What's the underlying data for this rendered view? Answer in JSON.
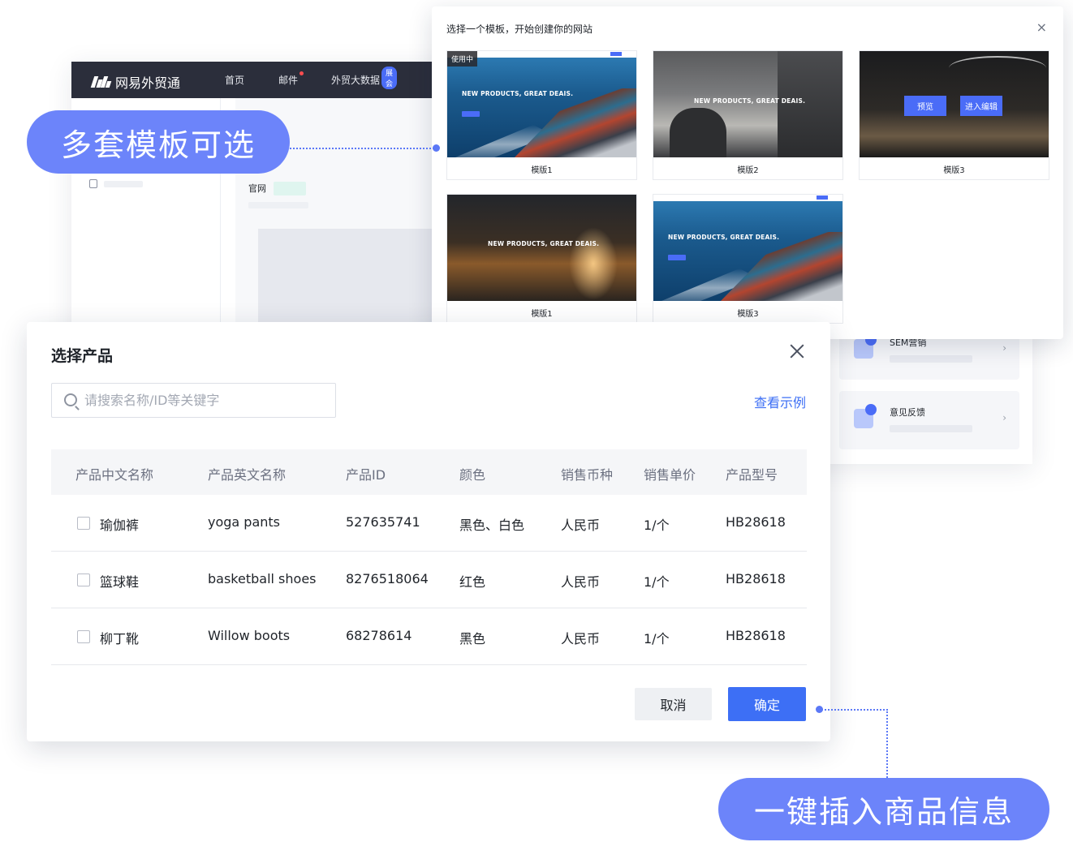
{
  "app": {
    "logo_text": "网易外贸通",
    "nav": [
      "首页",
      "邮件",
      "外贸大数据"
    ],
    "nav_badge": "展会",
    "section_label": "官网",
    "right_cards": [
      {
        "title": "SEM营销",
        "chevron": "›"
      },
      {
        "title": "意见反馈",
        "chevron": "›"
      }
    ]
  },
  "template_modal": {
    "title": "选择一个模板，开始创建你的网站",
    "close": "×",
    "in_use_badge": "使用中",
    "hero_text": "NEW PRODUCTS, GREAT DEAIS.",
    "preview_button": "预览",
    "edit_button": "进入编辑",
    "templates": [
      {
        "label": "模版1"
      },
      {
        "label": "模版2"
      },
      {
        "label": "模版3"
      },
      {
        "label": "模版1"
      },
      {
        "label": "模版3"
      }
    ]
  },
  "product_modal": {
    "title": "选择产品",
    "search_placeholder": "请搜索名称/ID等关键字",
    "example_link": "查看示例",
    "columns": [
      "产品中文名称",
      "产品英文名称",
      "产品ID",
      "颜色",
      "销售币种",
      "销售单价",
      "产品型号"
    ],
    "rows": [
      {
        "cn": "瑜伽裤",
        "en": "yoga pants",
        "id": "527635741",
        "color": "黑色、白色",
        "currency": "人民币",
        "price": "1/个",
        "model": "HB28618"
      },
      {
        "cn": "篮球鞋",
        "en": "basketball shoes",
        "id": "8276518064",
        "color": "红色",
        "currency": "人民币",
        "price": "1/个",
        "model": "HB28618"
      },
      {
        "cn": "柳丁靴",
        "en": "Willow boots",
        "id": "68278614",
        "color": "黑色",
        "currency": "人民币",
        "price": "1/个",
        "model": "HB28618"
      }
    ],
    "cancel": "取消",
    "confirm": "确定"
  },
  "callouts": {
    "templates": "多套模板可选",
    "insert": "一键插入商品信息"
  },
  "colors": {
    "accent": "#3d6ff5",
    "callout": "#6c84fa",
    "topbar": "#2b2e3b"
  }
}
